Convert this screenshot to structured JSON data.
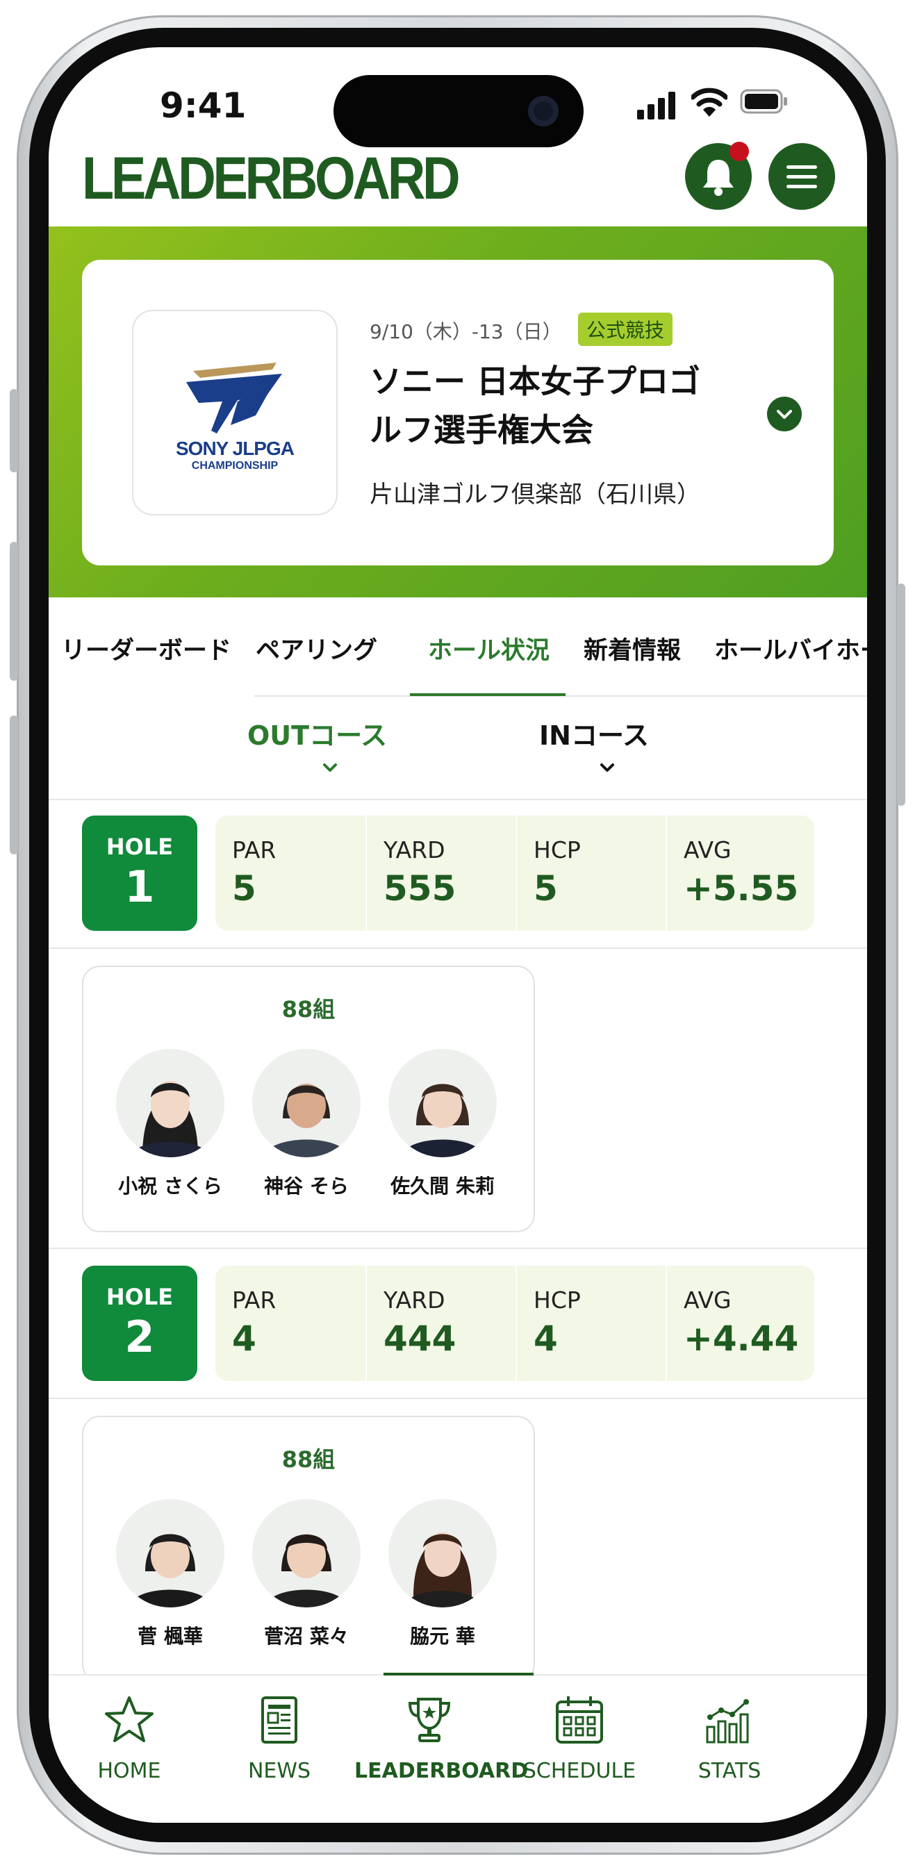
{
  "status_bar": {
    "time": "9:41"
  },
  "header": {
    "title": "LEADERBOARD",
    "bell_icon": "bell-icon",
    "menu_icon": "hamburger-menu-icon"
  },
  "tournament": {
    "logo_text": "SONY JLPGA",
    "logo_subtext": "CHAMPIONSHIP",
    "dates": "9/10（木）-13（日）",
    "badge": "公式競技",
    "title": "ソニー 日本女子プロゴルフ選手権大会",
    "venue": "片山津ゴルフ倶楽部（石川県）"
  },
  "tabs": [
    "リーダーボード",
    "ペアリング",
    "ホール状況",
    "新着情報",
    "ホールバイホール"
  ],
  "active_tab": "ホール状況",
  "course_tabs": {
    "out": "OUTコース",
    "in": "INコース"
  },
  "holes": [
    {
      "label": "HOLE",
      "number": "1",
      "par_label": "PAR",
      "par": "5",
      "yard_label": "YARD",
      "yard": "555",
      "hcp_label": "HCP",
      "hcp": "5",
      "avg_label": "AVG",
      "avg": "+5.55",
      "group": {
        "name": "88組",
        "players": [
          "小祝 さくら",
          "神谷 そら",
          "佐久間 朱莉"
        ]
      }
    },
    {
      "label": "HOLE",
      "number": "2",
      "par_label": "PAR",
      "par": "4",
      "yard_label": "YARD",
      "yard": "444",
      "hcp_label": "HCP",
      "hcp": "4",
      "avg_label": "AVG",
      "avg": "+4.44",
      "group": {
        "name": "88組",
        "players": [
          "菅 楓華",
          "菅沼 菜々",
          "脇元 華"
        ]
      }
    }
  ],
  "bottom_nav": [
    {
      "label": "HOME",
      "icon": "star-icon"
    },
    {
      "label": "NEWS",
      "icon": "newspaper-icon"
    },
    {
      "label": "LEADERBOARD",
      "icon": "trophy-icon"
    },
    {
      "label": "SCHEDULE",
      "icon": "calendar-icon"
    },
    {
      "label": "STATS",
      "icon": "bar-chart-icon"
    }
  ],
  "colors": {
    "brand_green": "#1f5b20",
    "accent_green": "#108a3b",
    "lime": "#94c11d",
    "notification_red": "#c8101c"
  }
}
